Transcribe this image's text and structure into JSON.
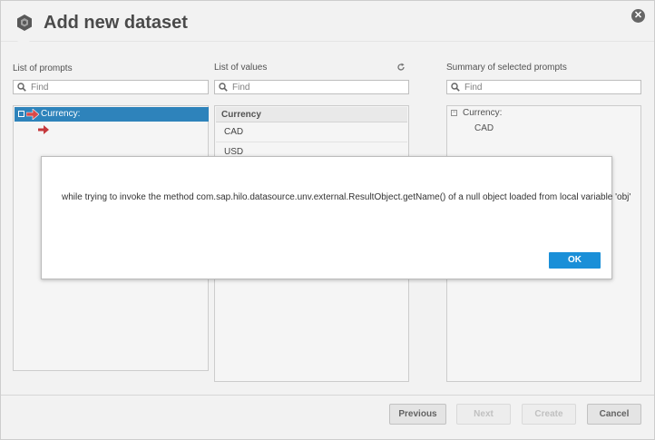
{
  "app": {
    "title": "Add new dataset",
    "icon": "cube-logo-icon",
    "close_icon": "close-icon"
  },
  "columns": {
    "prompts": {
      "label": "List of prompts",
      "search_placeholder": "Find",
      "items": [
        {
          "label": "Currency:",
          "selected": true
        }
      ]
    },
    "values": {
      "label": "List of values",
      "search_placeholder": "Find",
      "refresh_icon": "refresh-icon",
      "header": "Currency",
      "items": [
        "CAD",
        "USD"
      ]
    },
    "summary": {
      "label": "Summary of selected prompts",
      "search_placeholder": "Find",
      "group_label": "Currency:",
      "group_values": [
        "CAD"
      ]
    }
  },
  "footer": {
    "previous_label": "Previous",
    "next_label": "Next",
    "create_label": "Create",
    "cancel_label": "Cancel"
  },
  "error_dialog": {
    "message": "while trying to invoke the method com.sap.hilo.datasource.unv.external.ResultObject.getName() of a null object loaded from local variable 'obj'",
    "ok_label": "OK"
  },
  "colors": {
    "selection": "#1d79b6",
    "ok_button": "#1a8fd8",
    "red_arrow": "#c0282c"
  }
}
